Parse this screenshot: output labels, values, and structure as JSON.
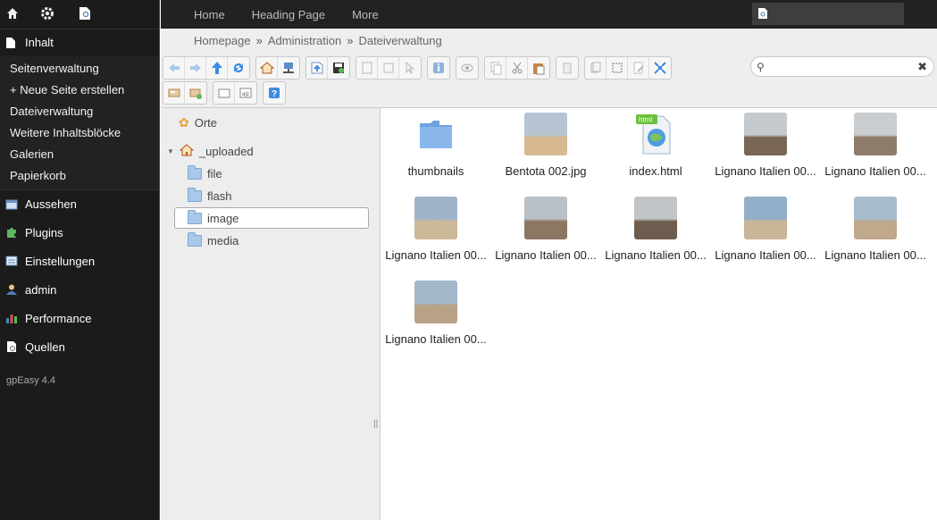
{
  "sidebar": {
    "top_icons": [
      "home-icon",
      "gear-icon",
      "page-icon"
    ],
    "inhalt_label": "Inhalt",
    "inhalt_items": [
      "Seitenverwaltung",
      "+ Neue Seite erstellen",
      "Dateiverwaltung",
      "Weitere Inhaltsblöcke",
      "Galerien",
      "Papierkorb"
    ],
    "sections": [
      {
        "label": "Aussehen",
        "icon": "appearance-icon"
      },
      {
        "label": "Plugins",
        "icon": "puzzle-icon"
      },
      {
        "label": "Einstellungen",
        "icon": "settings-panel-icon"
      },
      {
        "label": "admin",
        "icon": "user-icon"
      },
      {
        "label": "Performance",
        "icon": "bar-chart-icon"
      },
      {
        "label": "Quellen",
        "icon": "resources-icon"
      }
    ],
    "version": "gpEasy 4.4"
  },
  "topnav": {
    "items": [
      "Home",
      "Heading Page",
      "More"
    ]
  },
  "breadcrumb": {
    "items": [
      "Homepage",
      "Administration",
      "Dateiverwaltung"
    ],
    "separator": "»"
  },
  "search": {
    "value": "",
    "placeholder": ""
  },
  "tree": {
    "places_label": "Orte",
    "root_label": "_uploaded",
    "folders": [
      "file",
      "flash",
      "image",
      "media"
    ],
    "selected": "image"
  },
  "files": [
    {
      "name": "thumbnails",
      "type": "folder"
    },
    {
      "name": "Bentota  002.jpg",
      "type": "image",
      "sky": "#b6c4d2",
      "ground": "#d7b891"
    },
    {
      "name": "index.html",
      "type": "html"
    },
    {
      "name": "Lignano Italien 00...",
      "type": "image",
      "sky": "#c4c9cd",
      "ground": "#7a6654"
    },
    {
      "name": "Lignano Italien 00...",
      "type": "image",
      "sky": "#c9cdd0",
      "ground": "#8e7c6a"
    },
    {
      "name": "Lignano Italien 00...",
      "type": "image",
      "sky": "#9fb4c8",
      "ground": "#cdb89a"
    },
    {
      "name": "Lignano Italien 00...",
      "type": "image",
      "sky": "#b9c0c6",
      "ground": "#8c7763"
    },
    {
      "name": "Lignano Italien 00...",
      "type": "image",
      "sky": "#c0c4c7",
      "ground": "#6e5d4e"
    },
    {
      "name": "Lignano Italien 00...",
      "type": "image",
      "sky": "#93aec9",
      "ground": "#c9b597"
    },
    {
      "name": "Lignano Italien 00...",
      "type": "image",
      "sky": "#a9bccd",
      "ground": "#bfa88c"
    },
    {
      "name": "Lignano Italien 00...",
      "type": "image",
      "sky": "#a3b7cb",
      "ground": "#b9a287"
    }
  ]
}
